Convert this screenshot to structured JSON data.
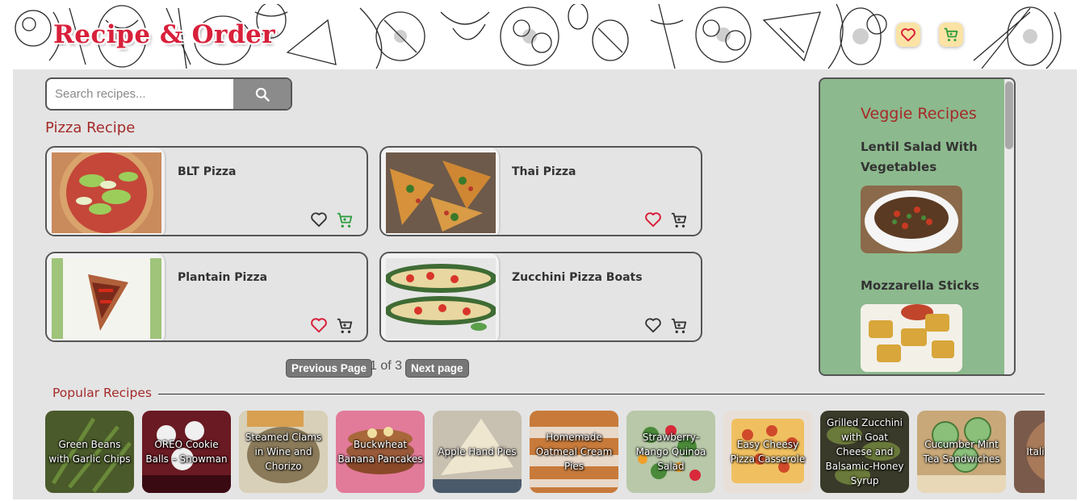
{
  "header": {
    "logo": "Recipe & Order",
    "favorites_icon": "heart-icon",
    "cart_icon": "cart-icon"
  },
  "search": {
    "placeholder": "Search recipes...",
    "value": "",
    "button_icon": "search-icon"
  },
  "section_title": "Pizza Recipe",
  "recipes": [
    {
      "title": "BLT Pizza",
      "favorited": false,
      "in_cart": true
    },
    {
      "title": "Thai Pizza",
      "favorited": true,
      "in_cart": false
    },
    {
      "title": "Plantain Pizza",
      "favorited": true,
      "in_cart": false
    },
    {
      "title": "Zucchini Pizza Boats",
      "favorited": false,
      "in_cart": false
    }
  ],
  "pagination": {
    "prev_label": "Previous Page",
    "info": "1 of 3",
    "next_label": "Next page"
  },
  "veggie": {
    "title": "Veggie Recipes",
    "items": [
      {
        "name": "Lentil Salad With Vegetables"
      },
      {
        "name": "Mozzarella Sticks"
      }
    ]
  },
  "popular": {
    "title": "Popular Recipes",
    "items": [
      {
        "name": "Green Beans with Garlic Chips"
      },
      {
        "name": "OREO Cookie Balls – Snowman"
      },
      {
        "name": "Steamed Clams in Wine and Chorizo"
      },
      {
        "name": "Buckwheat Banana Pancakes"
      },
      {
        "name": "Apple Hand Pies"
      },
      {
        "name": "Homemade Oatmeal Cream Pies"
      },
      {
        "name": "Strawberry-Mango Quinoa Salad"
      },
      {
        "name": "Easy Cheesy Pizza Casserole"
      },
      {
        "name": "Grilled Zucchini with Goat Cheese and Balsamic-Honey Syrup"
      },
      {
        "name": "Cucumber Mint Tea Sandwiches"
      },
      {
        "name": "Italian with H"
      }
    ]
  },
  "colors": {
    "accent_red": "#a52a2a",
    "favorite_red": "#d8203a",
    "cart_green": "#2e9e3e",
    "panel_green": "#8cb98d",
    "header_button": "#fbe3a5"
  }
}
